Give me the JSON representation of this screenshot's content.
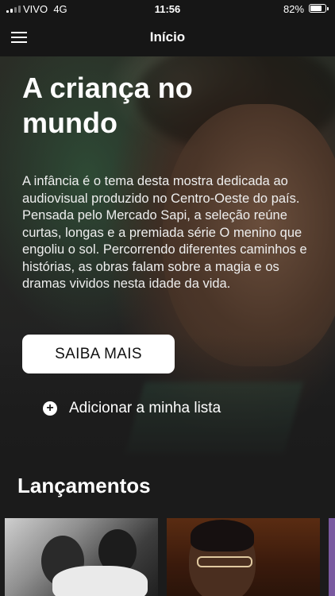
{
  "status_bar": {
    "carrier": "VIVO",
    "network": "4G",
    "time": "11:56",
    "battery": "82%",
    "battery_level": 0.82
  },
  "nav": {
    "title": "Início",
    "menu_icon": "hamburger-menu-icon"
  },
  "hero": {
    "title": "A criança no mundo",
    "description": "A infância é o tema desta mostra dedicada ao audiovisual produzido no Centro-Oeste do país. Pensada pelo Mercado Sapi, a seleção reúne curtas, longas e a premiada série O menino que engoliu o sol. Percorrendo diferentes caminhos e histórias, as obras falam sobre a magia e os dramas vividos nesta idade da vida.",
    "cta_label": "SAIBA MAIS",
    "add_label": "Adicionar a minha lista",
    "add_icon": "plus-circle-icon"
  },
  "releases": {
    "title": "Lançamentos"
  },
  "colors": {
    "background": "#1b1b1b",
    "bar": "#161616",
    "button": "#ffffff"
  }
}
